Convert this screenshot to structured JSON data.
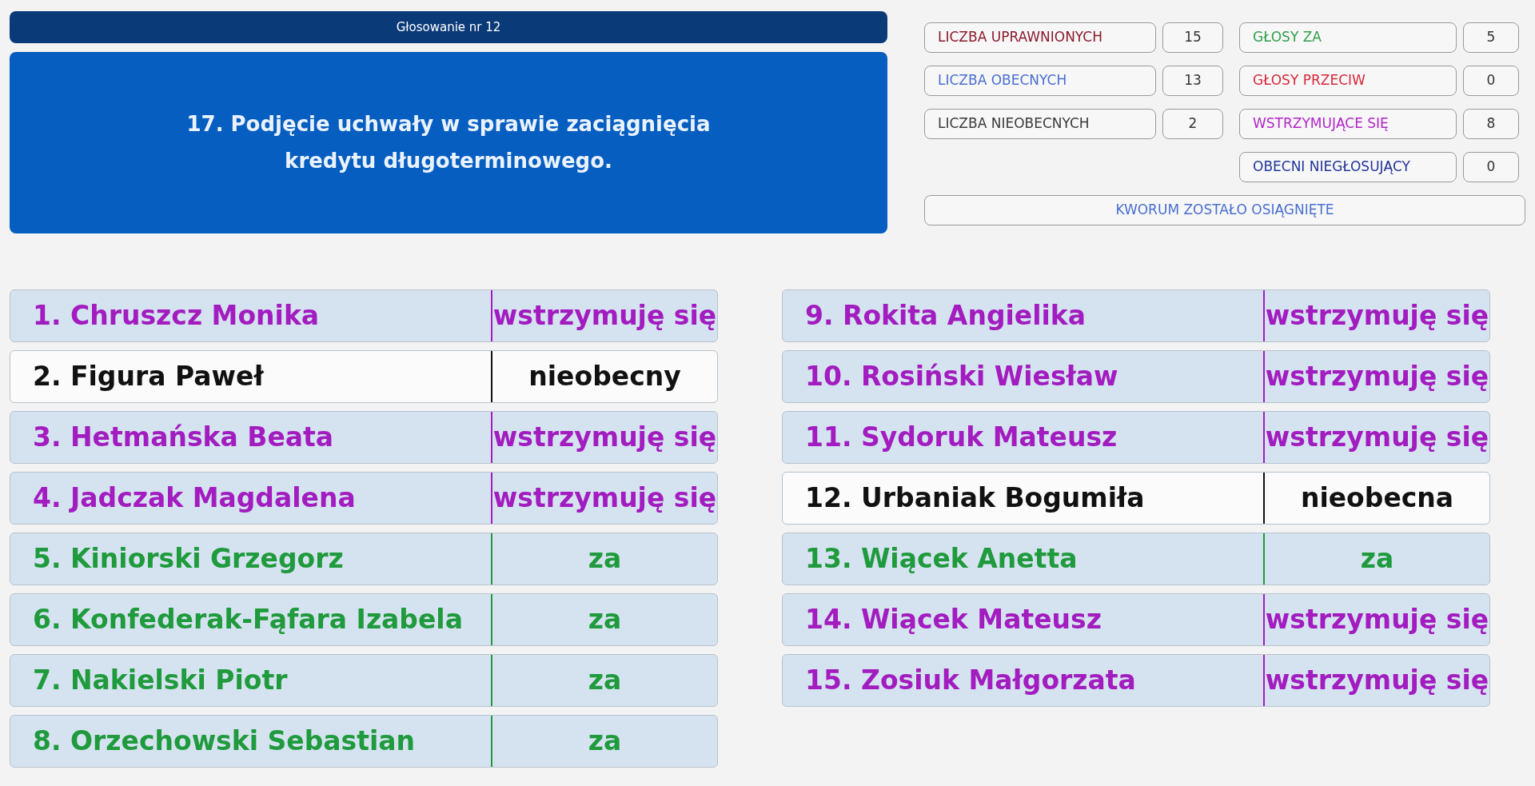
{
  "header": {
    "title": "Głosowanie nr 12"
  },
  "agenda_item": {
    "text": "17. Podjęcie uchwały w sprawie zaciągnięcia kredytu długoterminowego."
  },
  "stats_left": [
    {
      "label": "LICZBA UPRAWNIONYCH",
      "value": "15",
      "color": "#8b1a2b"
    },
    {
      "label": "LICZBA OBECNYCH",
      "value": "13",
      "color": "#4a6fd0"
    },
    {
      "label": "LICZBA NIEOBECNYCH",
      "value": "2",
      "color": "#3a3a3a"
    }
  ],
  "stats_right": [
    {
      "label": "GŁOSY ZA",
      "value": "5",
      "color": "#2e9e4a"
    },
    {
      "label": "GŁOSY PRZECIW",
      "value": "0",
      "color": "#d8283a"
    },
    {
      "label": "WSTRZYMUJĄCE SIĘ",
      "value": "8",
      "color": "#b026c8"
    },
    {
      "label": "OBECNI NIEGŁOSUJĄCY",
      "value": "0",
      "color": "#23349a"
    }
  ],
  "quorum": {
    "text": "KWORUM ZOSTAŁO OSIĄGNIĘTE"
  },
  "member_columns": [
    {
      "members": [
        {
          "name": "1. Chruszcz Monika",
          "vote": "wstrzymuję się",
          "kind": "abstain"
        },
        {
          "name": "2. Figura Paweł",
          "vote": "nieobecny",
          "kind": "absent"
        },
        {
          "name": "3. Hetmańska Beata",
          "vote": "wstrzymuję się",
          "kind": "abstain"
        },
        {
          "name": "4. Jadczak Magdalena",
          "vote": "wstrzymuję się",
          "kind": "abstain"
        },
        {
          "name": "5. Kiniorski Grzegorz",
          "vote": "za",
          "kind": "for"
        },
        {
          "name": "6. Konfederak-Fąfara Izabela",
          "vote": "za",
          "kind": "for"
        },
        {
          "name": "7. Nakielski Piotr",
          "vote": "za",
          "kind": "for"
        },
        {
          "name": "8. Orzechowski Sebastian",
          "vote": "za",
          "kind": "for"
        }
      ]
    },
    {
      "members": [
        {
          "name": "9. Rokita Angielika",
          "vote": "wstrzymuję się",
          "kind": "abstain"
        },
        {
          "name": "10. Rosiński Wiesław",
          "vote": "wstrzymuję się",
          "kind": "abstain"
        },
        {
          "name": "11. Sydoruk Mateusz",
          "vote": "wstrzymuję się",
          "kind": "abstain"
        },
        {
          "name": "12. Urbaniak Bogumiła",
          "vote": "nieobecna",
          "kind": "absent"
        },
        {
          "name": "13. Wiącek Anetta",
          "vote": "za",
          "kind": "for"
        },
        {
          "name": "14. Wiącek Mateusz",
          "vote": "wstrzymuję się",
          "kind": "abstain"
        },
        {
          "name": "15. Zosiuk Małgorzata",
          "vote": "wstrzymuję się",
          "kind": "abstain"
        }
      ]
    }
  ]
}
